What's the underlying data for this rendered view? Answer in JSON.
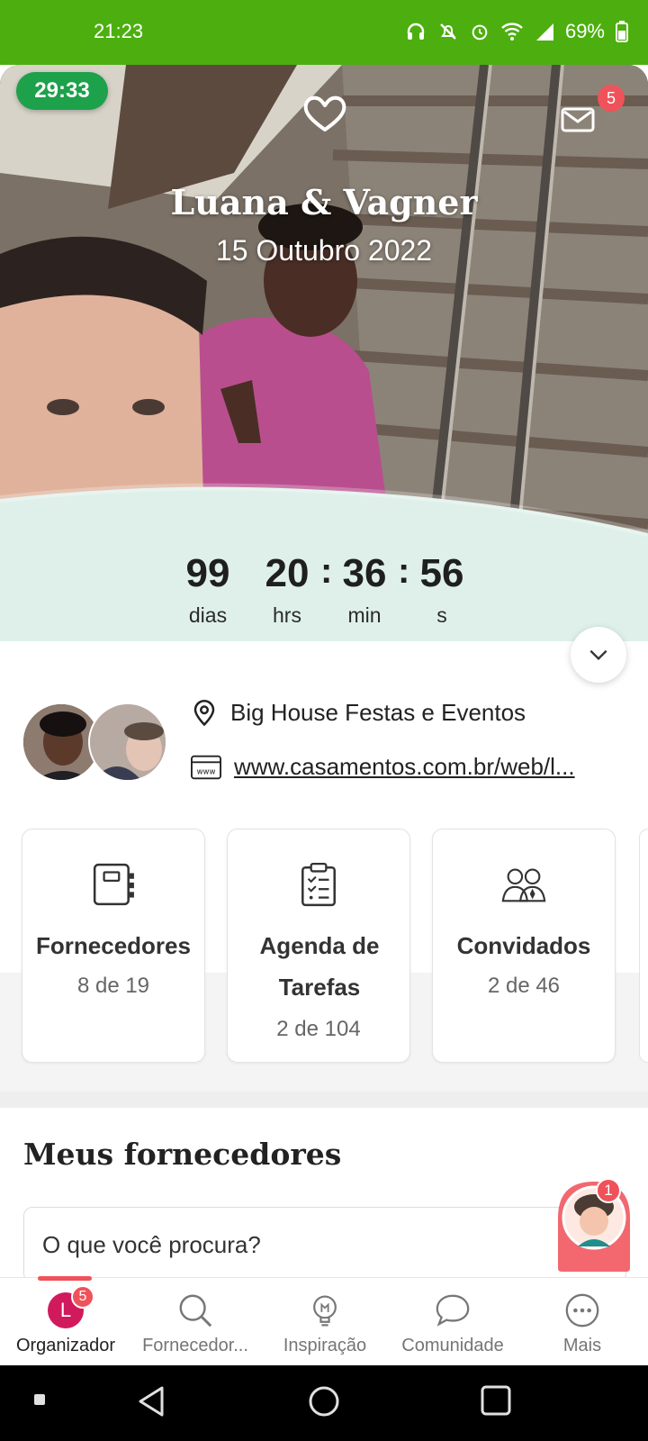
{
  "status_bar": {
    "time": "21:23",
    "battery": "69%"
  },
  "hero": {
    "timer": "29:33",
    "couple_names": "Luana & Vagner",
    "wedding_date": "15 Outubro 2022",
    "messages_badge": "5",
    "countdown": {
      "days": "99",
      "days_label": "dias",
      "hours": "20",
      "hours_label": "hrs",
      "minutes": "36",
      "minutes_label": "min",
      "seconds": "56",
      "seconds_label": "s",
      "separator": ":"
    }
  },
  "info": {
    "venue": "Big House Festas e Eventos",
    "website": "www.casamentos.com.br/web/l..."
  },
  "cards": [
    {
      "title": "Fornecedores",
      "count": "8 de 19",
      "icon": "notebook-icon"
    },
    {
      "title": "Agenda de Tarefas",
      "count": "2 de 104",
      "icon": "clipboard-icon"
    },
    {
      "title": "Convidados",
      "count": "2 de 46",
      "icon": "guests-icon"
    }
  ],
  "suppliers_section": {
    "title": "Meus fornecedores",
    "search_placeholder": "O que você procura?"
  },
  "assistant_badge": "1",
  "bottom_nav": {
    "items": [
      {
        "label": "Organizador",
        "avatar_letter": "L",
        "badge": "5"
      },
      {
        "label": "Fornecedor..."
      },
      {
        "label": "Inspiração"
      },
      {
        "label": "Comunidade"
      },
      {
        "label": "Mais"
      }
    ]
  },
  "colors": {
    "status_bar": "#4caf0f",
    "mint": "#dff0ea",
    "timer_pill": "#1da14a",
    "badge": "#f0525a",
    "avatar": "#d11a5c"
  }
}
